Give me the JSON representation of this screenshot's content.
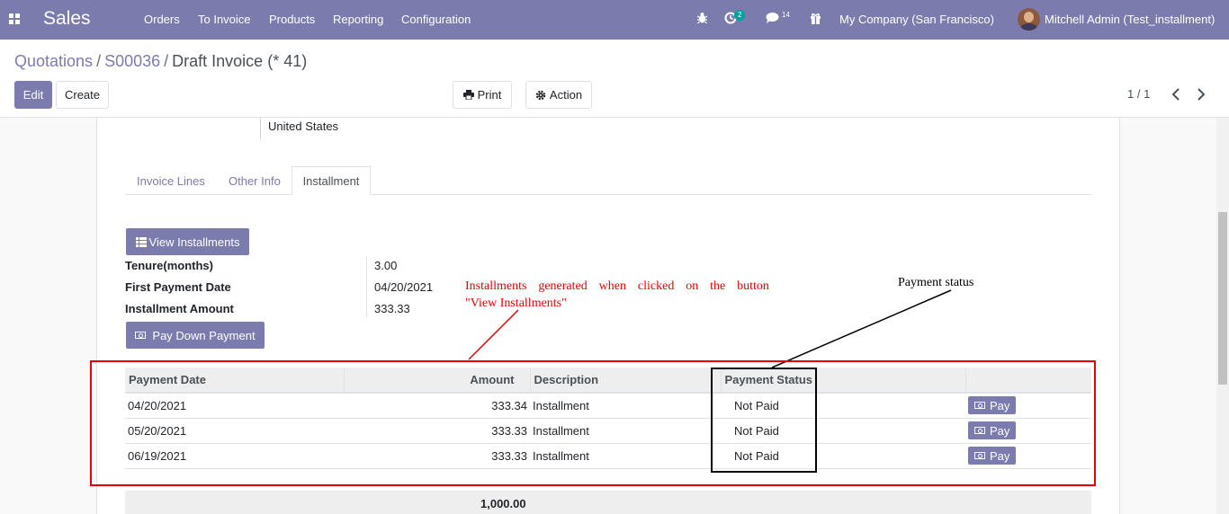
{
  "navbar": {
    "brand": "Sales",
    "menu": [
      "Orders",
      "To Invoice",
      "Products",
      "Reporting",
      "Configuration"
    ],
    "activity_count": "2",
    "messages_count": "14",
    "company": "My Company (San Francisco)",
    "user": "Mitchell Admin (Test_installment)",
    "icons": [
      "apps-icon",
      "bug-icon",
      "clock-icon",
      "chat-icon",
      "gift-icon"
    ]
  },
  "breadcrumb": {
    "items": [
      "Quotations",
      "S00036"
    ],
    "current": "Draft Invoice (* 41)"
  },
  "buttons": {
    "edit": "Edit",
    "create": "Create",
    "print": "Print",
    "action": "Action"
  },
  "pager": "1 / 1",
  "address": "United States",
  "tabs": [
    "Invoice Lines",
    "Other Info",
    "Installment"
  ],
  "installment": {
    "view_button": "View Installments",
    "fields": [
      {
        "label": "Tenure(months)",
        "value": "3.00"
      },
      {
        "label": "First Payment Date",
        "value": "04/20/2021"
      },
      {
        "label": "Installment Amount",
        "value": "333.33"
      }
    ],
    "pay_down_button": "Pay Down Payment",
    "table": {
      "columns": [
        "Payment Date",
        "Amount",
        "Description",
        "Payment Status",
        ""
      ],
      "rows": [
        {
          "date": "04/20/2021",
          "amount": "333.34",
          "description": "Installment",
          "status": "Not Paid",
          "action": "Pay"
        },
        {
          "date": "05/20/2021",
          "amount": "333.33",
          "description": "Installment",
          "status": "Not Paid",
          "action": "Pay"
        },
        {
          "date": "06/19/2021",
          "amount": "333.33",
          "description": "Installment",
          "status": "Not Paid",
          "action": "Pay"
        }
      ],
      "total": "1,000.00"
    }
  },
  "annotations": {
    "installments_words": [
      "Installments",
      "generated",
      "when",
      "clicked",
      "on",
      "the",
      "button"
    ],
    "installments_line2": "\"View Installments\"",
    "payment_status": "Payment status",
    "colors": {
      "red": "#ee0000",
      "black": "#000000"
    }
  },
  "colors": {
    "brand": "#7c7bad",
    "teal_badge": "#00a09d"
  }
}
